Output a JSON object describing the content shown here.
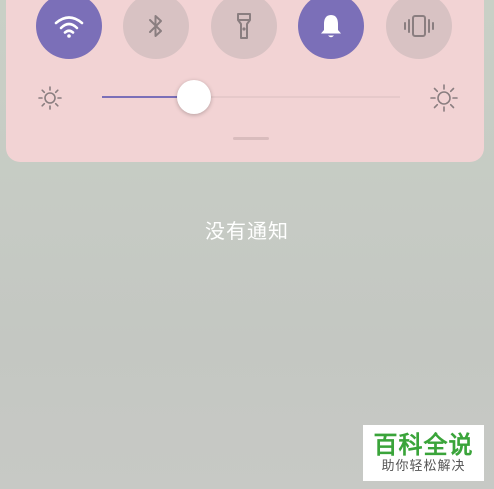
{
  "quick_settings": {
    "tiles": [
      {
        "icon": "wifi-icon",
        "state": "on"
      },
      {
        "icon": "bluetooth-icon",
        "state": "off"
      },
      {
        "icon": "flashlight-icon",
        "state": "off"
      },
      {
        "icon": "bell-icon",
        "state": "on"
      },
      {
        "icon": "vibrate-icon",
        "state": "off"
      }
    ],
    "brightness": {
      "level_fraction": 0.31,
      "low_icon": "brightness-low-icon",
      "high_icon": "brightness-high-icon"
    }
  },
  "notifications": {
    "empty_text": "没有通知"
  },
  "watermark": {
    "main": "百科全说",
    "sub": "助你轻松解决"
  },
  "colors": {
    "panel": "#f2d3d4",
    "tile_on": "#7b6fb8",
    "tile_off": "#d8c2c3",
    "slider_fill": "#7b6fb8",
    "watermark_green": "#3aa43a"
  }
}
